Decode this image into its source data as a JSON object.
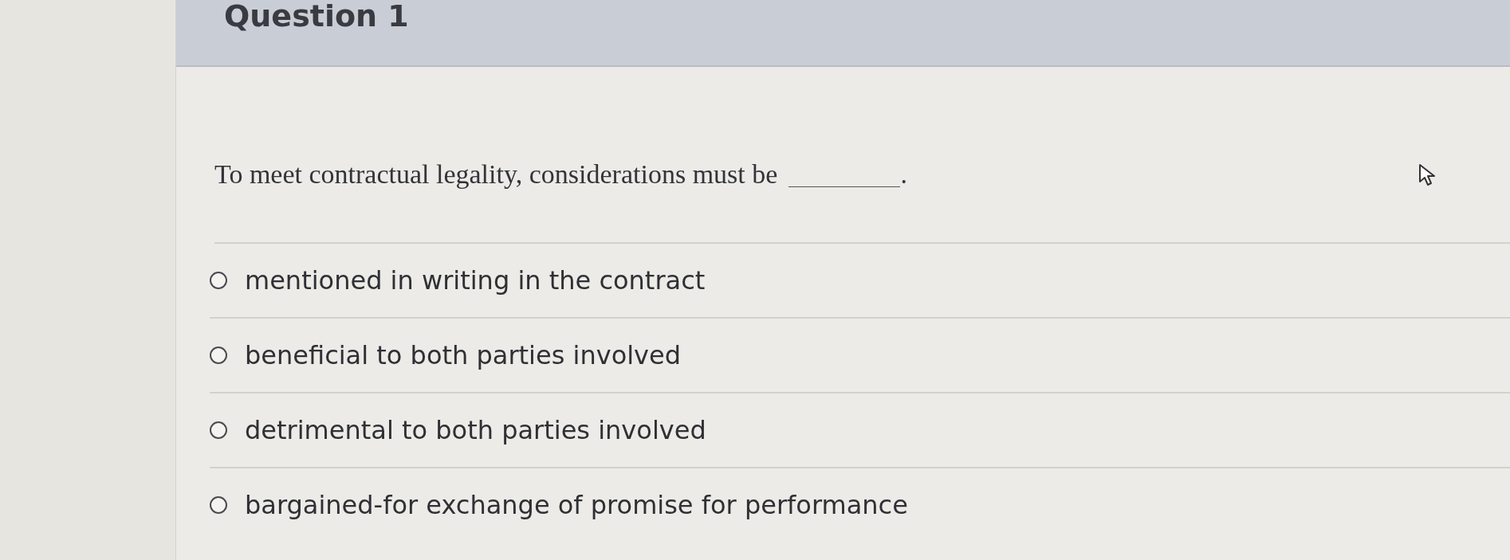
{
  "header": {
    "title": "Question 1"
  },
  "question": {
    "text": "To meet contractual legality, considerations must be",
    "end_mark": "."
  },
  "options": [
    {
      "label": "mentioned in writing in the contract",
      "selected": false
    },
    {
      "label": "beneficial to both parties involved",
      "selected": false
    },
    {
      "label": "detrimental to both parties involved",
      "selected": false
    },
    {
      "label": "bargained-for exchange of promise for performance",
      "selected": false
    }
  ]
}
